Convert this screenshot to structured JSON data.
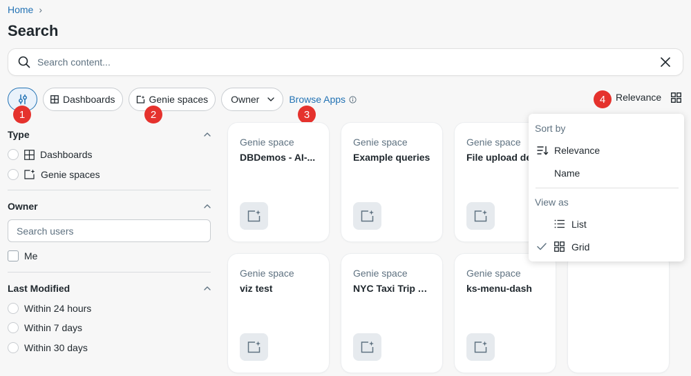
{
  "breadcrumb": {
    "home": "Home",
    "sep": "›"
  },
  "page": {
    "title": "Search"
  },
  "search": {
    "placeholder": "Search content..."
  },
  "filters": {
    "dashboards_label": "Dashboards",
    "genie_label": "Genie spaces",
    "owner_label": "Owner",
    "browse_apps_label": "Browse Apps"
  },
  "markers": [
    "1",
    "2",
    "3",
    "4"
  ],
  "sort": {
    "label": "Relevance"
  },
  "sidebar": {
    "type": {
      "title": "Type",
      "options": [
        {
          "label": "Dashboards",
          "icon": "dashboard-icon"
        },
        {
          "label": "Genie spaces",
          "icon": "genie-space-icon"
        }
      ]
    },
    "owner": {
      "title": "Owner",
      "placeholder": "Search users",
      "me_label": "Me"
    },
    "last_modified": {
      "title": "Last Modified",
      "options": [
        "Within 24 hours",
        "Within 7 days",
        "Within 30 days"
      ]
    }
  },
  "cards": [
    {
      "type": "Genie space",
      "title": "DBDemos - AI-..."
    },
    {
      "type": "Genie space",
      "title": "Example queries"
    },
    {
      "type": "Genie space",
      "title": "File upload de"
    },
    {
      "type": "Genie space",
      "title": "viz test"
    },
    {
      "type": "Genie space",
      "title": "NYC Taxi Trip A..."
    },
    {
      "type": "Genie space",
      "title": "ks-menu-dash"
    },
    {
      "type": "",
      "title": ""
    }
  ],
  "menu": {
    "sort_by_header": "Sort by",
    "sort_options": [
      "Relevance",
      "Name"
    ],
    "view_as_header": "View as",
    "view_options": [
      "List",
      "Grid"
    ],
    "selected_view": "Grid"
  },
  "colors": {
    "accent": "#2272b4",
    "marker": "#e5322d",
    "text": "#1f272d",
    "muted": "#5f7281"
  }
}
